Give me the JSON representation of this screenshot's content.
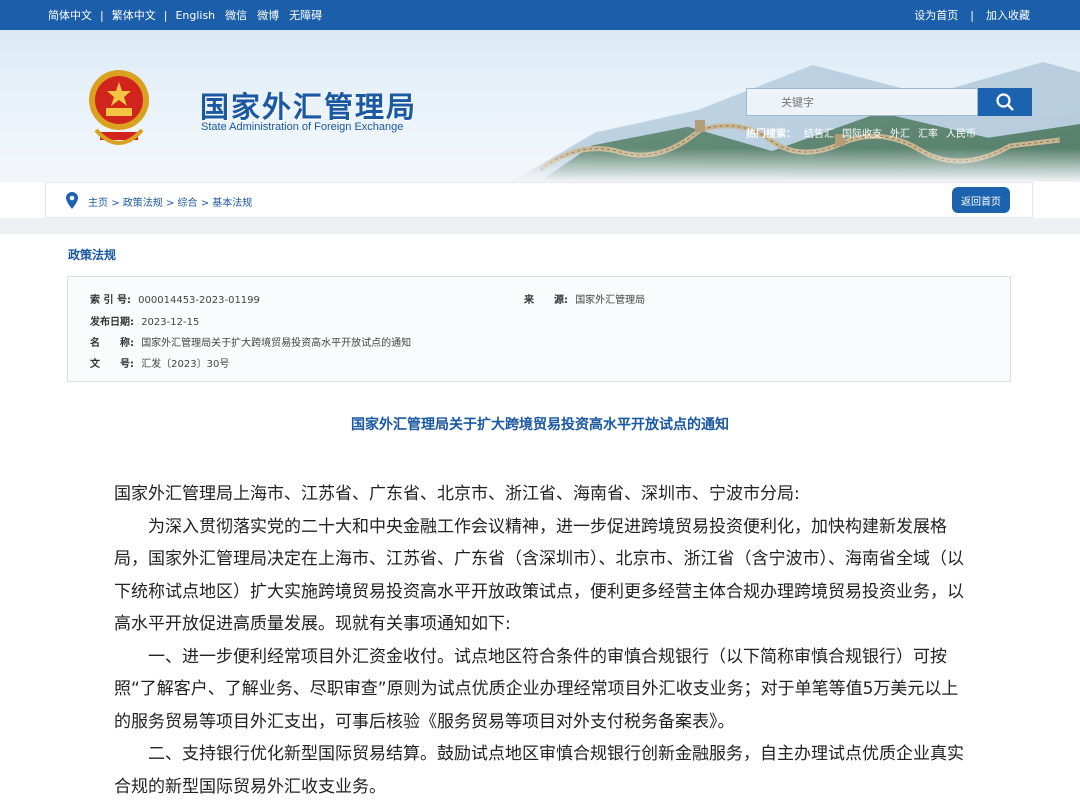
{
  "topbar": {
    "lang_simplified": "简体中文",
    "sep": "|",
    "lang_traditional": "繁体中文",
    "lang_english": "English",
    "wechat": "微信",
    "weibo": "微博",
    "accessibility": "无障碍",
    "set_home": "设为首页",
    "add_favorite": "加入收藏"
  },
  "header": {
    "title": "国家外汇管理局",
    "subtitle": "State Administration of Foreign Exchange",
    "search_placeholder": "关键字",
    "hot_label": "热门搜索：",
    "hot_terms": [
      "结售汇",
      "国际收支",
      "外汇",
      "汇率",
      "人民币"
    ]
  },
  "breadcrumb": {
    "items": [
      "主页",
      "政策法规",
      "综合",
      "基本法规"
    ],
    "separator": ">",
    "back_label": "返回首页"
  },
  "section_title": "政策法规",
  "meta": {
    "index_label": "索 引 号:",
    "index_value": "000014453-2023-01199",
    "source_label": "来　　源:",
    "source_value": "国家外汇管理局",
    "date_label": "发布日期:",
    "date_value": "2023-12-15",
    "name_label": "名　　称:",
    "name_value": "国家外汇管理局关于扩大跨境贸易投资高水平开放试点的通知",
    "docno_label": "文　　号:",
    "docno_value": "汇发〔2023〕30号"
  },
  "document": {
    "title": "国家外汇管理局关于扩大跨境贸易投资高水平开放试点的通知",
    "salutation": "国家外汇管理局上海市、江苏省、广东省、北京市、浙江省、海南省、深圳市、宁波市分局:",
    "para1": "为深入贯彻落实党的二十大和中央金融工作会议精神，进一步促进跨境贸易投资便利化，加快构建新发展格局，国家外汇管理局决定在上海市、江苏省、广东省（含深圳市）、北京市、浙江省（含宁波市）、海南省全域（以下统称试点地区）扩大实施跨境贸易投资高水平开放政策试点，便利更多经营主体合规办理跨境贸易投资业务，以高水平开放促进高质量发展。现就有关事项通知如下:",
    "para2": "一、进一步便利经常项目外汇资金收付。试点地区符合条件的审慎合规银行（以下简称审慎合规银行）可按照“了解客户、了解业务、尽职审查”原则为试点优质企业办理经常项目外汇收支业务；对于单笔等值5万美元以上的服务贸易等项目外汇支出，可事后核验《服务贸易等项目对外支付税务备案表》。",
    "para3": "二、支持银行优化新型国际贸易结算。鼓励试点地区审慎合规银行创新金融服务，自主办理试点优质企业真实合规的新型国际贸易外汇收支业务。"
  },
  "colors": {
    "brand_blue": "#1b5faa",
    "link_blue": "#1b58a2"
  }
}
